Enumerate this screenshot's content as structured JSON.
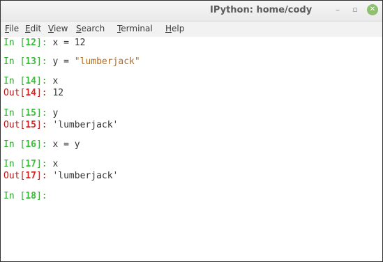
{
  "window": {
    "title": "IPython: home/cody",
    "min_glyph": "–",
    "max_glyph": "▫",
    "close_glyph": "✕"
  },
  "menu": [
    {
      "mnemonic": "F",
      "rest": "ile"
    },
    {
      "mnemonic": "E",
      "rest": "dit"
    },
    {
      "mnemonic": "V",
      "rest": "iew"
    },
    {
      "mnemonic": "S",
      "rest": "earch"
    },
    {
      "mnemonic": "T",
      "rest": "erminal"
    },
    {
      "mnemonic": "H",
      "rest": "elp"
    }
  ],
  "prompt": {
    "in_prefix": "In [",
    "out_prefix": "Out[",
    "suffix": "]: "
  },
  "session": {
    "l1": {
      "num": "12",
      "code": "x = 12"
    },
    "l2": {
      "num": "13",
      "code_pre": "y = ",
      "code_str": "\"lumberjack\""
    },
    "l3": {
      "num": "14",
      "code": "x"
    },
    "l3o": {
      "num": "14",
      "result": "12"
    },
    "l4": {
      "num": "15",
      "code": "y"
    },
    "l4o": {
      "num": "15",
      "result": "'lumberjack'"
    },
    "l5": {
      "num": "16",
      "code": "x = y"
    },
    "l6": {
      "num": "17",
      "code": "x"
    },
    "l6o": {
      "num": "17",
      "result": "'lumberjack'"
    },
    "l7": {
      "num": "18",
      "code": ""
    }
  },
  "colors": {
    "in_prompt": "#2fa62f",
    "in_number": "#36c036",
    "out_prompt": "#b21818",
    "out_number": "#e02020",
    "string": "#ba6a17",
    "text": "#333333"
  }
}
